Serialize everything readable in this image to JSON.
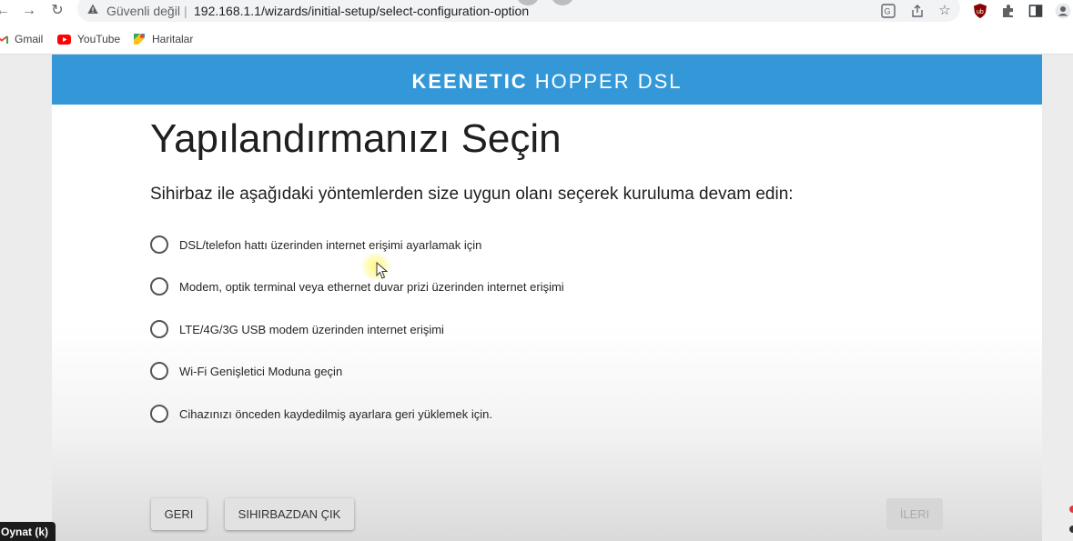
{
  "browser": {
    "security_label": "Güvenli değil",
    "url": "192.168.1.1/wizards/initial-setup/select-configuration-option",
    "bookmarks": [
      {
        "label": "Gmail",
        "icon": "gmail-icon"
      },
      {
        "label": "YouTube",
        "icon": "youtube-icon"
      },
      {
        "label": "Haritalar",
        "icon": "maps-icon"
      }
    ],
    "toolbar_icons": [
      "back-icon",
      "forward-icon",
      "reload-icon",
      "warning-icon",
      "translate-icon",
      "share-icon",
      "star-icon",
      "ublock-icon",
      "extensions-icon",
      "side-panel-icon",
      "profile-icon"
    ]
  },
  "header": {
    "brand_bold": "KEENETIC",
    "brand_light": "HOPPER DSL",
    "color": "#3498d8"
  },
  "main": {
    "title": "Yapılandırmanızı Seçin",
    "subtitle": "Sihirbaz ile aşağıdaki yöntemlerden size uygun olanı seçerek kuruluma devam edin:",
    "options": [
      {
        "label": "DSL/telefon hattı üzerinden internet erişimi ayarlamak için",
        "selected": false
      },
      {
        "label": "Modem, optik terminal veya ethernet duvar prizi üzerinden internet erişimi",
        "selected": false
      },
      {
        "label": "LTE/4G/3G USB modem üzerinden internet erişimi",
        "selected": false
      },
      {
        "label": "Wi-Fi Genişletici Moduna geçin",
        "selected": false
      },
      {
        "label": "Cihazınızı önceden kaydedilmiş ayarlara geri yüklemek için.",
        "selected": false
      }
    ]
  },
  "footer": {
    "back_label": "GERI",
    "exit_label": "SIHIRBAZDAN ÇIK",
    "next_label": "İLERI",
    "next_enabled": false
  },
  "overlay": {
    "tooltip": "Oynat (k)"
  }
}
